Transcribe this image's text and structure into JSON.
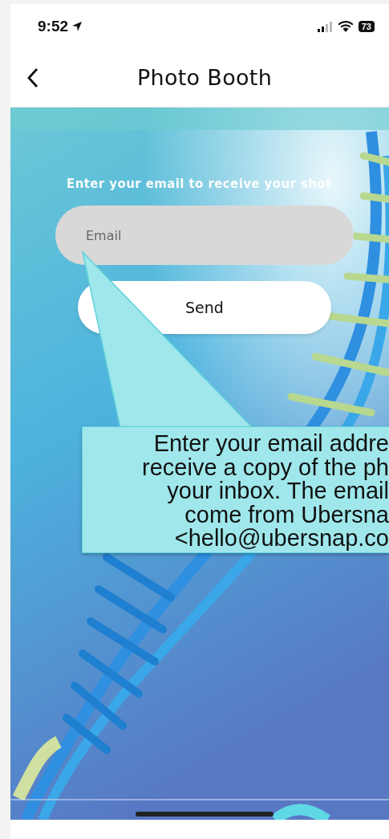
{
  "status_bar": {
    "time": "9:52",
    "battery": "73"
  },
  "nav": {
    "title": "Photo Booth"
  },
  "form": {
    "prompt": "Enter your email to receive your shot",
    "email": {
      "placeholder": "Email"
    },
    "send_button": "Send"
  },
  "callout": {
    "lines": [
      "Enter your email addre",
      "receive a copy of the ph",
      "your inbox. The email",
      "come from Ubersna",
      "<hello@ubersnap.co"
    ]
  }
}
